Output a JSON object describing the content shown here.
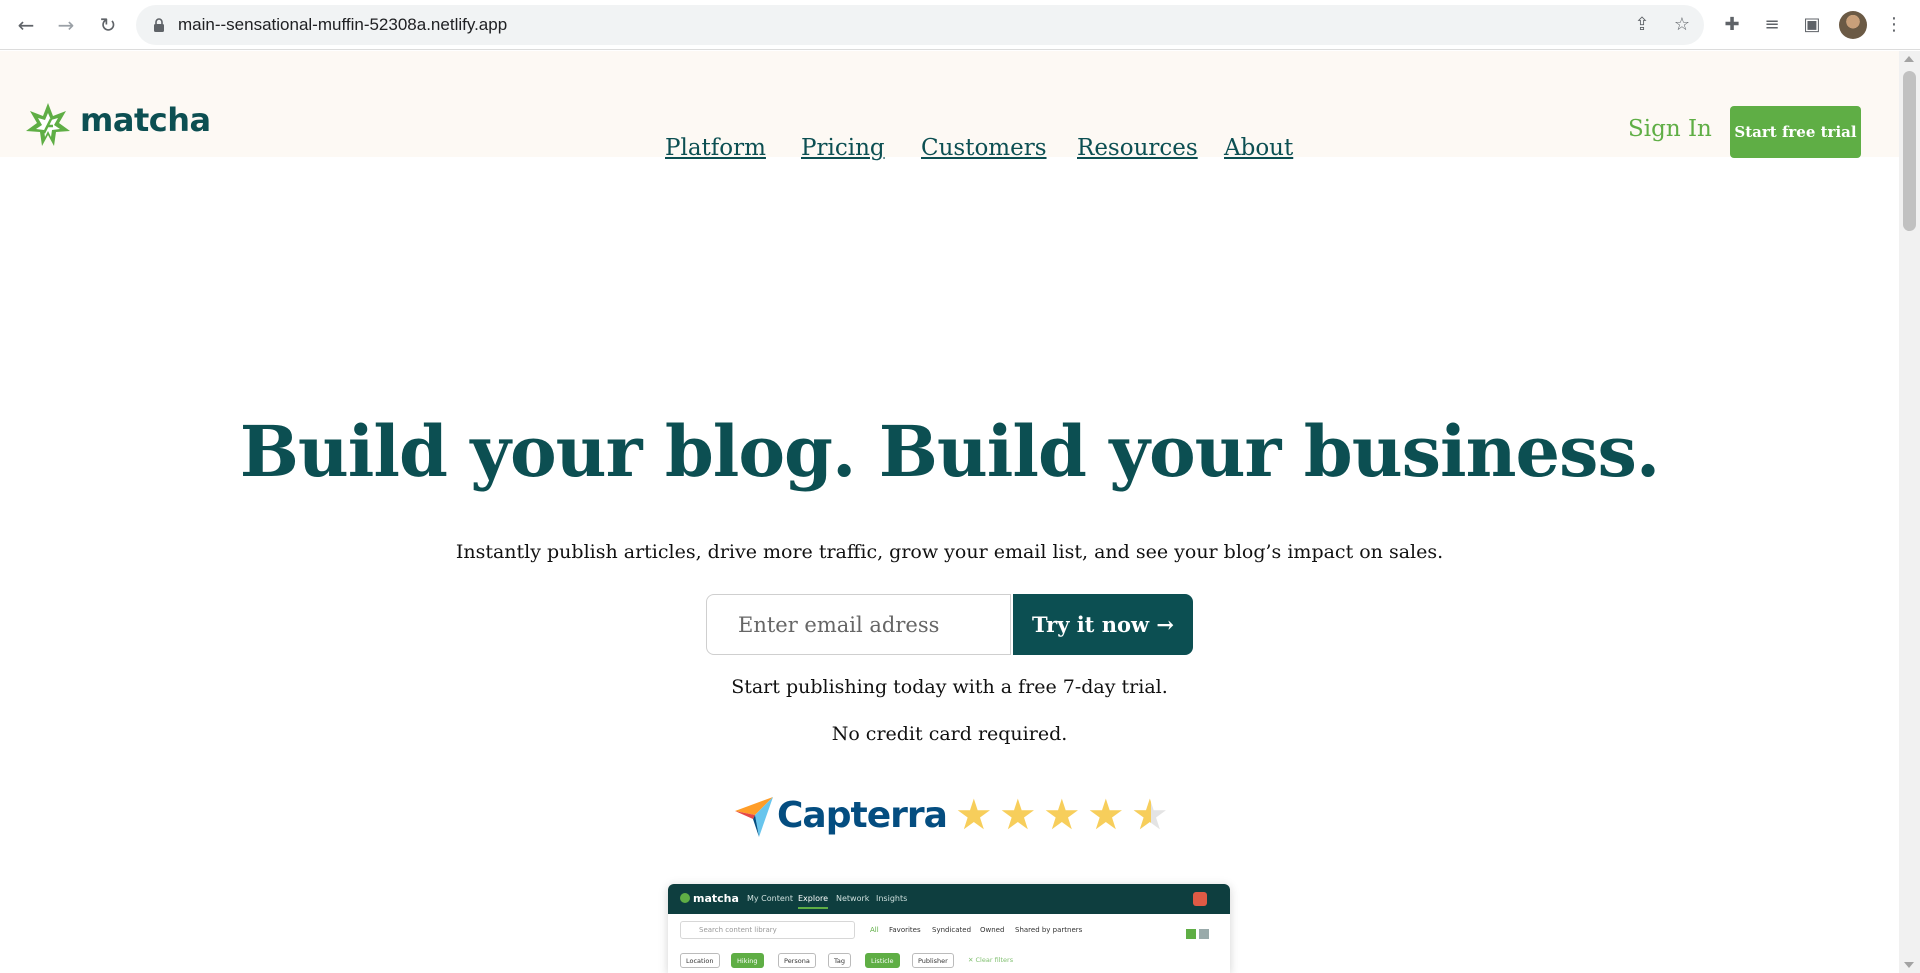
{
  "browser": {
    "url": "main--sensational-muffin-52308a.netlify.app",
    "icons": [
      "back-arrow-icon",
      "forward-arrow-icon",
      "reload-icon",
      "lock-icon",
      "share-icon",
      "star-bookmark-icon",
      "extensions-puzzle-icon",
      "media-queue-icon",
      "side-panel-icon",
      "avatar",
      "kebab-menu-icon"
    ]
  },
  "brand": {
    "name": "matcha",
    "primary_color": "#0c4f52",
    "accent_color": "#5fae45"
  },
  "nav": {
    "items": [
      {
        "label": "Platform"
      },
      {
        "label": "Pricing"
      },
      {
        "label": "Customers"
      },
      {
        "label": "Resources"
      },
      {
        "label": "About"
      }
    ],
    "signin_label": "Sign In",
    "trial_label": "Start free trial"
  },
  "hero": {
    "title": "Build your blog. Build your business.",
    "subtitle": "Instantly publish articles, drive more traffic, grow your email list, and see your blog’s impact on sales.",
    "email_placeholder": "Enter email adress",
    "cta_label": "Try it now →",
    "note_1": "Start publishing today with a free 7-day trial.",
    "note_2": "No credit card required."
  },
  "rating": {
    "provider": "Capterra",
    "stars": 4.5,
    "out_of": 5
  },
  "preview": {
    "logo": "matcha",
    "tabs": [
      "My Content",
      "Explore",
      "Network",
      "Insights"
    ],
    "active_tab": "Explore",
    "search_placeholder": "Search content library",
    "filters": [
      "All",
      "Favorites",
      "Syndicated",
      "Owned",
      "Shared by partners"
    ],
    "chips": [
      "Location",
      "Hiking",
      "Persona",
      "Tag",
      "Listicle",
      "Publisher"
    ],
    "active_chips": [
      "Hiking",
      "Listicle"
    ],
    "clear_label": "✕ Clear filters"
  }
}
